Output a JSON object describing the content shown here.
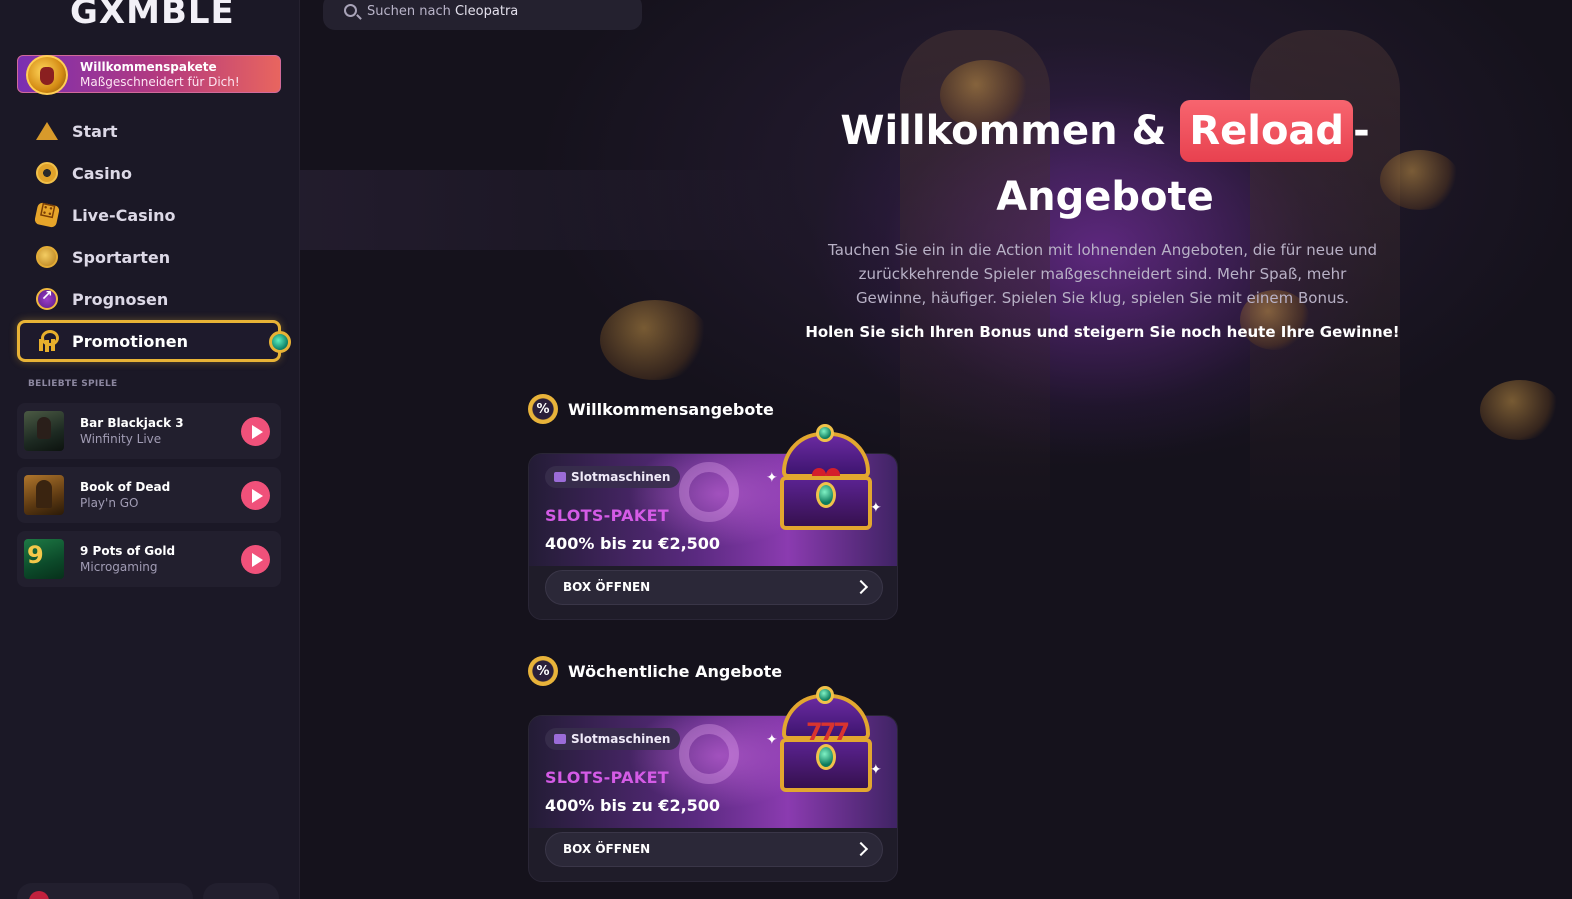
{
  "sidebar": {
    "logo": "GXMBLE",
    "welcome_banner": {
      "title": "Willkommenspakete",
      "subtitle": "Maßgeschneidert für Dich!"
    },
    "nav": [
      {
        "label": "Start",
        "icon": "pyramid-icon"
      },
      {
        "label": "Casino",
        "icon": "casino-chip-icon"
      },
      {
        "label": "Live-Casino",
        "icon": "dice-icon"
      },
      {
        "label": "Sportarten",
        "icon": "ball-icon"
      },
      {
        "label": "Prognosen",
        "icon": "chart-trend-icon"
      },
      {
        "label": "Promotionen",
        "icon": "ankh-icon",
        "active": true
      }
    ],
    "popular_label": "BELIEBTE SPIELE",
    "popular_games": [
      {
        "title": "Bar Blackjack 3",
        "provider": "Winfinity Live"
      },
      {
        "title": "Book of Dead",
        "provider": "Play'n GO"
      },
      {
        "title": "9 Pots of Gold",
        "provider": "Microgaming"
      }
    ]
  },
  "search": {
    "prefix": "Suchen nach",
    "suggestion": "Cleopatra"
  },
  "hero": {
    "title_part1": "Willkommen &",
    "title_highlight": "Reload",
    "title_part2": "-",
    "title_line2": "Angebote",
    "description": "Tauchen Sie ein in die Action mit lohnenden Angeboten, die für neue und zurückkehrende Spieler maßgeschneidert sind. Mehr Spaß, mehr Gewinne, häufiger. Spielen Sie klug, spielen Sie mit einem Bonus.",
    "cta": "Holen Sie sich Ihren Bonus und steigern Sie noch heute Ihre Gewinne!"
  },
  "sections": [
    {
      "heading": "Willkommensangebote",
      "icon_text": "%",
      "card": {
        "tag": "Slotmaschinen",
        "kicker": "SLOTS-PAKET",
        "amount": "400% bis zu €2,500",
        "button": "BOX ÖFFNEN"
      }
    },
    {
      "heading": "Wöchentliche Angebote",
      "icon_text": "%",
      "card": {
        "tag": "Slotmaschinen",
        "kicker": "SLOTS-PAKET",
        "amount": "400% bis zu €2,500",
        "button": "BOX ÖFFNEN"
      }
    }
  ],
  "colors": {
    "accent_gold": "#e8b336",
    "accent_pink": "#f0517a",
    "reload_badge": "#e8414f",
    "kicker_purple": "#d45be6"
  }
}
